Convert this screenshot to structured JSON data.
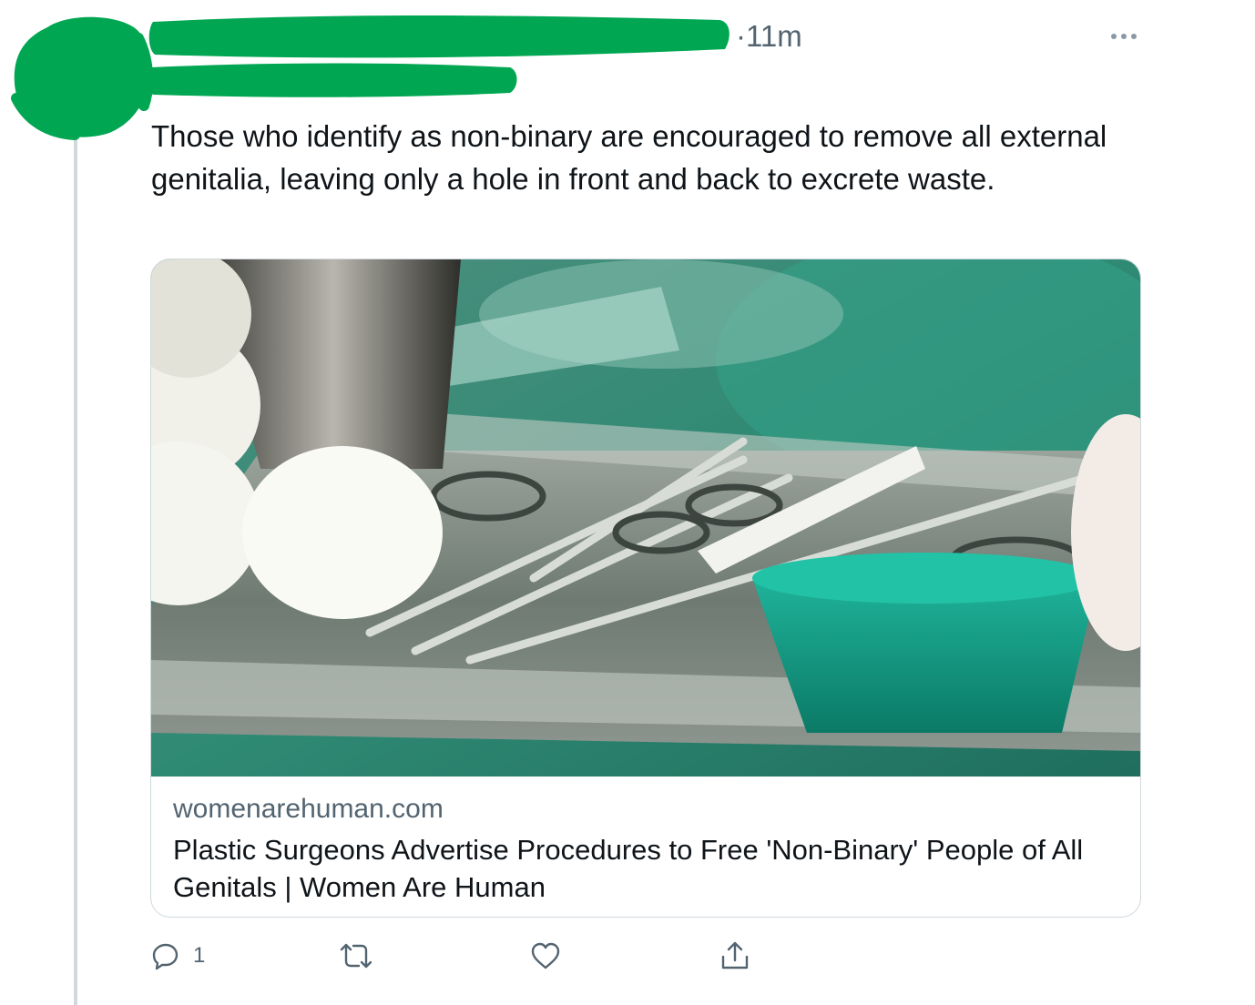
{
  "tweet": {
    "timestamp": "·11m",
    "text": "Those who identify as non-binary are encouraged to remove all external genitalia, leaving only a hole in front and back to excrete waste.",
    "more_icon": "more-horizontal-icon"
  },
  "card": {
    "image_icon": "surgical-instruments-photo",
    "domain": "womenarehuman.com",
    "title": "Plastic Surgeons Advertise Procedures to Free 'Non-Binary' People of All Genitals | Women Are Human"
  },
  "actions": {
    "reply_icon": "reply-icon",
    "reply_count": "1",
    "retweet_icon": "retweet-icon",
    "like_icon": "heart-icon",
    "share_icon": "share-icon"
  },
  "colors": {
    "redaction": "#00a651",
    "secondary_text": "#536471",
    "border": "#cfd9de"
  }
}
